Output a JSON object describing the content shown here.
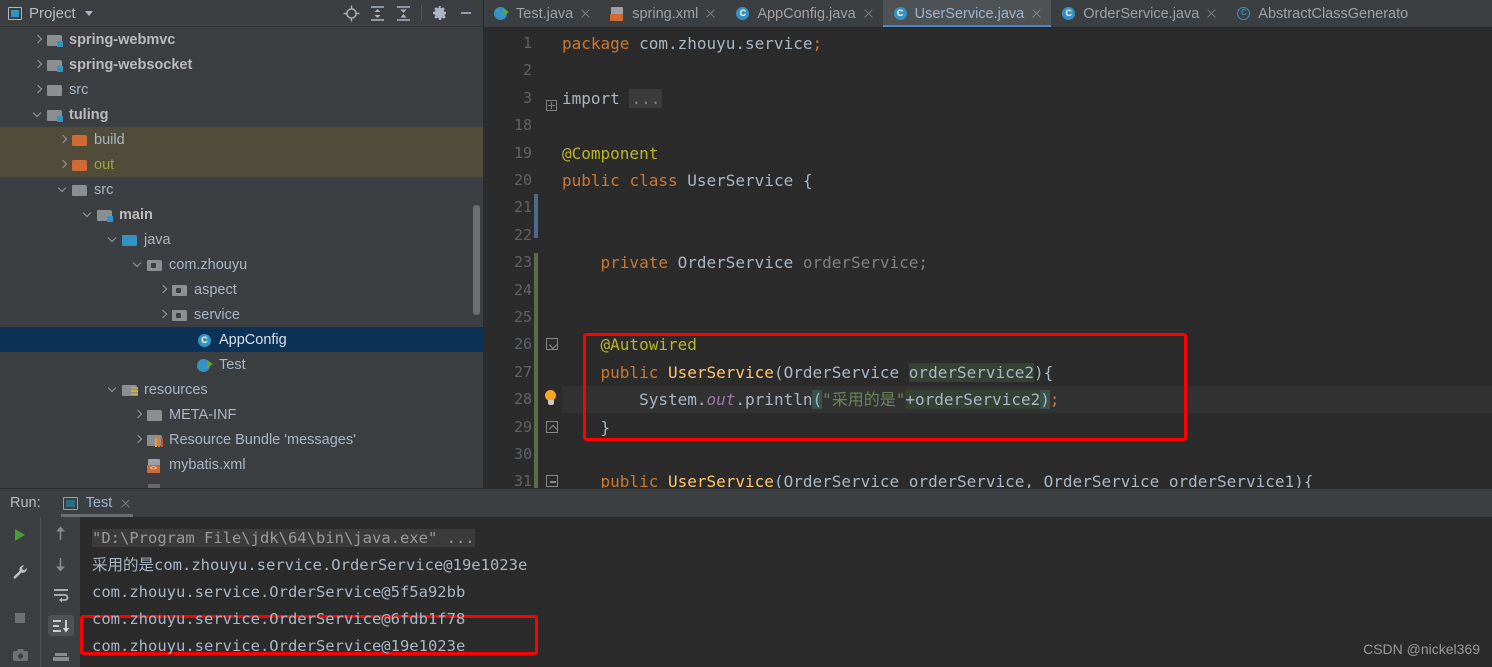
{
  "project_panel": {
    "title": "Project",
    "icons": [
      "locate-icon",
      "expand-all-icon",
      "collapse-all-icon",
      "settings-gear-icon",
      "minimize-icon"
    ],
    "tree": [
      {
        "label": "spring-webmvc",
        "indent": 1,
        "arrow": "right",
        "icon": "module-folder-icon",
        "style": "bold",
        "state": "normal"
      },
      {
        "label": "spring-websocket",
        "indent": 1,
        "arrow": "right",
        "icon": "module-folder-icon",
        "style": "bold",
        "state": "normal"
      },
      {
        "label": "src",
        "indent": 1,
        "arrow": "right",
        "icon": "folder-icon",
        "style": "plain",
        "state": "normal"
      },
      {
        "label": "tuling",
        "indent": 1,
        "arrow": "down",
        "icon": "module-folder-icon",
        "style": "bold",
        "state": "normal"
      },
      {
        "label": "build",
        "indent": 2,
        "arrow": "right",
        "icon": "folder-orange-icon",
        "style": "plain",
        "state": "excluded"
      },
      {
        "label": "out",
        "indent": 2,
        "arrow": "right",
        "icon": "folder-orange-icon",
        "style": "olive",
        "state": "excluded"
      },
      {
        "label": "src",
        "indent": 2,
        "arrow": "down",
        "icon": "folder-icon",
        "style": "plain",
        "state": "normal"
      },
      {
        "label": "main",
        "indent": 3,
        "arrow": "down",
        "icon": "module-folder-icon",
        "style": "bold",
        "state": "normal"
      },
      {
        "label": "java",
        "indent": 4,
        "arrow": "down",
        "icon": "source-root-icon",
        "style": "plain",
        "state": "normal"
      },
      {
        "label": "com.zhouyu",
        "indent": 5,
        "arrow": "down",
        "icon": "package-icon",
        "style": "plain",
        "state": "normal"
      },
      {
        "label": "aspect",
        "indent": 6,
        "arrow": "right",
        "icon": "package-icon",
        "style": "plain",
        "state": "normal"
      },
      {
        "label": "service",
        "indent": 6,
        "arrow": "right",
        "icon": "package-icon",
        "style": "plain",
        "state": "normal"
      },
      {
        "label": "AppConfig",
        "indent": 7,
        "arrow": "none",
        "icon": "java-class-icon",
        "style": "plain",
        "state": "selected"
      },
      {
        "label": "Test",
        "indent": 7,
        "arrow": "none",
        "icon": "java-runnable-class-icon",
        "style": "plain",
        "state": "normal"
      },
      {
        "label": "resources",
        "indent": 4,
        "arrow": "down",
        "icon": "resources-folder-icon",
        "style": "plain",
        "state": "normal"
      },
      {
        "label": "META-INF",
        "indent": 5,
        "arrow": "right",
        "icon": "folder-icon",
        "style": "plain",
        "state": "normal"
      },
      {
        "label": "Resource Bundle 'messages'",
        "indent": 5,
        "arrow": "right",
        "icon": "resource-bundle-icon",
        "style": "plain",
        "state": "normal"
      },
      {
        "label": "mybatis.xml",
        "indent": 5,
        "arrow": "none",
        "icon": "xml-file-icon",
        "style": "plain",
        "state": "normal"
      }
    ]
  },
  "editor": {
    "tabs": [
      {
        "label": "Test.java",
        "icon": "java-runnable-class-icon",
        "active": false,
        "closable": true
      },
      {
        "label": "spring.xml",
        "icon": "spring-xml-icon",
        "active": false,
        "closable": true
      },
      {
        "label": "AppConfig.java",
        "icon": "java-class-icon",
        "active": false,
        "closable": true
      },
      {
        "label": "UserService.java",
        "icon": "java-class-icon",
        "active": true,
        "closable": true
      },
      {
        "label": "OrderService.java",
        "icon": "java-class-icon",
        "active": false,
        "closable": true
      },
      {
        "label": "AbstractClassGenerato",
        "icon": "abstract-class-icon",
        "active": false,
        "closable": false
      }
    ],
    "line_numbers": [
      "1",
      "2",
      "3",
      "18",
      "19",
      "20",
      "21",
      "22",
      "23",
      "24",
      "25",
      "26",
      "27",
      "28",
      "29",
      "30",
      "31"
    ],
    "code": [
      {
        "num": "1",
        "text": "package com.zhouyu.service;"
      },
      {
        "num": "2",
        "text": ""
      },
      {
        "num": "3",
        "text": "import ..."
      },
      {
        "num": "18",
        "text": ""
      },
      {
        "num": "19",
        "text": "@Component"
      },
      {
        "num": "20",
        "text": "public class UserService {"
      },
      {
        "num": "21",
        "text": ""
      },
      {
        "num": "22",
        "text": ""
      },
      {
        "num": "23",
        "text": "    private OrderService orderService;"
      },
      {
        "num": "24",
        "text": ""
      },
      {
        "num": "25",
        "text": ""
      },
      {
        "num": "26",
        "text": "    @Autowired"
      },
      {
        "num": "27",
        "text": "    public UserService(OrderService orderService2){"
      },
      {
        "num": "28",
        "text": "        System.out.println(\"采用的是\"+orderService2);"
      },
      {
        "num": "29",
        "text": "    }"
      },
      {
        "num": "30",
        "text": ""
      },
      {
        "num": "31",
        "text": "    public UserService(OrderService orderService, OrderService orderService1){"
      }
    ],
    "fold_placeholder": "...",
    "gutter_bulb": "intention-bulb-icon"
  },
  "run_panel": {
    "run_label": "Run:",
    "tab_name": "Test",
    "left_buttons": [
      "run-icon",
      "wrench-icon",
      "stop-icon",
      "camera-icon"
    ],
    "right_buttons": [
      "up-arrow-icon",
      "down-arrow-icon",
      "soft-wrap-icon",
      "scroll-to-end-icon",
      "print-icon"
    ],
    "console_lines": [
      {
        "text": "\"D:\\Program File\\jdk\\64\\bin\\java.exe\" ...",
        "style": "command"
      },
      {
        "text": "采用的是com.zhouyu.service.OrderService@19e1023e",
        "style": "output"
      },
      {
        "text": "com.zhouyu.service.OrderService@5f5a92bb",
        "style": "output"
      },
      {
        "text": "com.zhouyu.service.OrderService@6fdb1f78",
        "style": "output"
      },
      {
        "text": "com.zhouyu.service.OrderService@19e1023e",
        "style": "output-highlighted"
      }
    ]
  },
  "annotations": {
    "highlight_color": "#ff0000",
    "code_rect_label": "red-rectangle-around-constructor",
    "console_rect_label": "red-rectangle-around-last-output"
  },
  "watermark": "CSDN @nickel369",
  "colors": {
    "editor_bg": "#2b2b2b",
    "panel_bg": "#3c3f41",
    "selection_blue": "#0d3257",
    "excluded_olive": "#514b3a",
    "accent_blue": "#4a88c7",
    "keyword_orange": "#cc7832",
    "string_green": "#6a8759",
    "annotation_yellow": "#bbb529",
    "method_yellow": "#ffc66d",
    "field_purple": "#9876aa"
  }
}
